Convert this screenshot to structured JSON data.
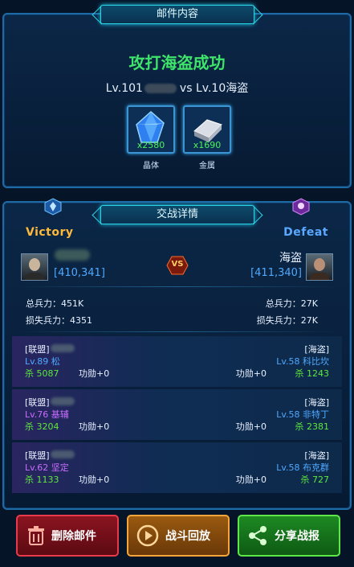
{
  "mail": {
    "tab_title": "邮件内容",
    "result_title": "攻打海盗成功",
    "attacker_level": "Lv.101",
    "vs_word": "vs",
    "defender_level": "Lv.10海盗",
    "rewards": [
      {
        "icon": "crystal-icon",
        "qty": "x2580",
        "label": "晶体"
      },
      {
        "icon": "metal-icon",
        "qty": "x1690",
        "label": "金属"
      }
    ]
  },
  "battle": {
    "tab_title": "交战详情",
    "left_badge": "Victory",
    "right_badge": "Defeat",
    "vs_badge": "VS",
    "attacker": {
      "power": "[410,341]",
      "total_troops": "总兵力：451K",
      "lost_troops": "损失兵力：4351"
    },
    "defender": {
      "name": "海盗",
      "power": "[411,340]",
      "total_troops": "总兵力：27K",
      "lost_troops": "损失兵力：27K"
    },
    "rows": [
      {
        "l_tag": "[联盟]",
        "l_name": "Lv.89 松",
        "l_kills": "杀 5087",
        "l_merit": "功勋+0",
        "r_tag": "[海盗]",
        "r_name": "Lv.58 科比坎",
        "r_merit": "功勋+0",
        "r_kills": "杀 1243"
      },
      {
        "l_tag": "[联盟]",
        "l_name": "Lv.76 基辅",
        "l_kills": "杀 3204",
        "l_merit": "功勋+0",
        "r_tag": "[海盗]",
        "r_name": "Lv.58 非特丁",
        "r_merit": "功勋+0",
        "r_kills": "杀 2381"
      },
      {
        "l_tag": "[联盟]",
        "l_name": "Lv.62 坚定",
        "l_kills": "杀 1133",
        "l_merit": "功勋+0",
        "r_tag": "[海盗]",
        "r_name": "Lv.58 布克群",
        "r_merit": "功勋+0",
        "r_kills": "杀 727"
      }
    ]
  },
  "buttons": {
    "delete": "删除邮件",
    "replay": "战斗回放",
    "share": "分享战报"
  },
  "colors": {
    "victory": "#3ee56a",
    "defeat_badge": "#5aa8ff",
    "victory_badge": "#ffb93a"
  }
}
